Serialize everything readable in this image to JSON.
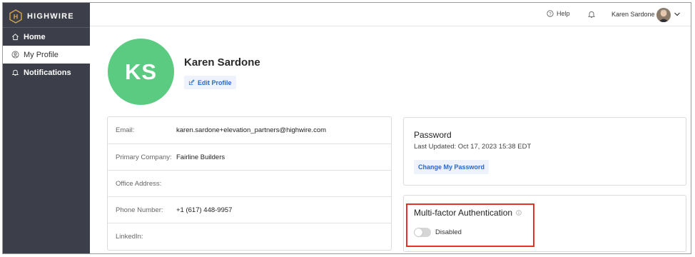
{
  "brand": {
    "name": "HIGHWIRE",
    "accent": "#d4a84b"
  },
  "sidebar": {
    "items": [
      {
        "label": "Home",
        "icon": "home-icon"
      },
      {
        "label": "My Profile",
        "icon": "user-icon",
        "active": true
      },
      {
        "label": "Notifications",
        "icon": "bell-icon"
      }
    ]
  },
  "topbar": {
    "help_label": "Help",
    "user_name": "Karen Sardone"
  },
  "profile": {
    "initials": "KS",
    "name": "Karen Sardone",
    "edit_label": "Edit Profile",
    "avatar_color": "#5ccb82"
  },
  "details": [
    {
      "label": "Email:",
      "value": "karen.sardone+elevation_partners@highwire.com"
    },
    {
      "label": "Primary Company:",
      "value": "Fairline Builders"
    },
    {
      "label": "Office Address:",
      "value": ""
    },
    {
      "label": "Phone Number:",
      "value": "+1 (617) 448-9957"
    },
    {
      "label": "LinkedIn:",
      "value": ""
    }
  ],
  "password": {
    "title": "Password",
    "last_updated": "Last Updated: Oct 17, 2023 15:38 EDT",
    "button_label": "Change My Password"
  },
  "mfa": {
    "title": "Multi-factor Authentication",
    "status_label": "Disabled",
    "enabled": false,
    "highlight_color": "#e2342b"
  }
}
